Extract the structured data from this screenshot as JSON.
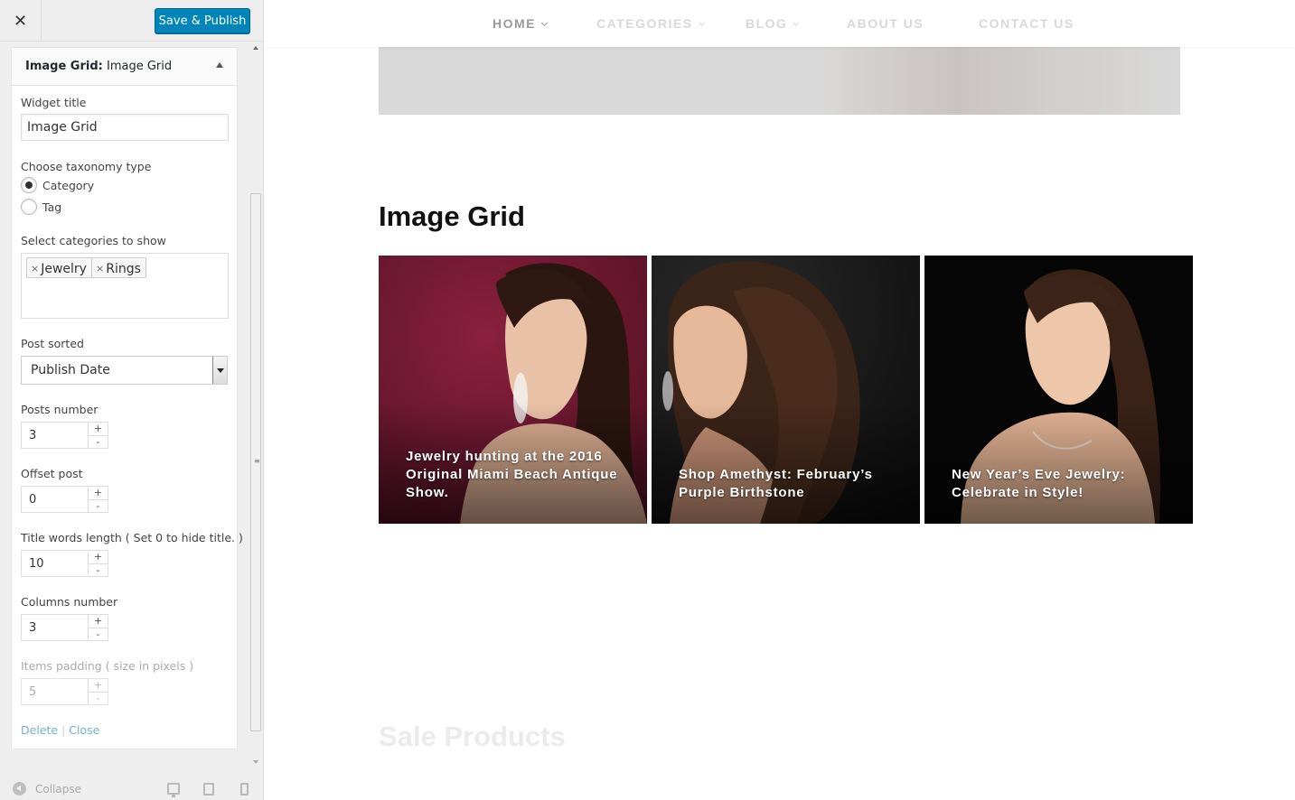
{
  "header": {
    "close_icon": "close-icon",
    "save_label": "Save & Publish"
  },
  "widget": {
    "title_prefix": "Image Grid:",
    "title_name": "Image Grid",
    "fields": {
      "widget_title_label": "Widget title",
      "widget_title_value": "Image Grid",
      "taxonomy_label": "Choose taxonomy type",
      "taxonomy_options": [
        "Category",
        "Tag"
      ],
      "taxonomy_selected": "Category",
      "categories_label": "Select categories to show",
      "categories": [
        "Jewelry",
        "Rings"
      ],
      "sorted_label": "Post sorted",
      "sorted_value": "Publish Date",
      "posts_number_label": "Posts number",
      "posts_number": "3",
      "offset_label": "Offset post",
      "offset": "0",
      "title_length_label": "Title words length ( Set 0 to hide title. )",
      "title_length": "10",
      "columns_label": "Columns number",
      "columns": "3",
      "padding_label": "Items padding ( size in pixels )",
      "padding": "5"
    },
    "delete_label": "Delete",
    "link_separator": "|",
    "close_label": "Close"
  },
  "footer": {
    "collapse_label": "Collapse"
  },
  "nav": {
    "items": [
      {
        "label": "HOME",
        "dropdown": true,
        "active": true
      },
      {
        "label": "CATEGORIES",
        "dropdown": true,
        "active": false
      },
      {
        "label": "BLOG",
        "dropdown": true,
        "active": false
      },
      {
        "label": "ABOUT US",
        "dropdown": false,
        "active": false
      },
      {
        "label": "CONTACT US",
        "dropdown": false,
        "active": false
      }
    ]
  },
  "preview": {
    "section_title": "Image Grid",
    "grid": [
      {
        "title": "Jewelry hunting at the 2016 Original Miami Beach Antique Show.",
        "bg": "#7a1a35"
      },
      {
        "title": "Shop Amethyst: February’s Purple Birthstone",
        "bg": "#141414"
      },
      {
        "title": "New Year’s Eve Jewelry: Celebrate in Style!",
        "bg": "#070707"
      }
    ],
    "next_section_title": "Sale Products"
  },
  "colors": {
    "primary": "#0085ba",
    "link": "#0073aa"
  }
}
